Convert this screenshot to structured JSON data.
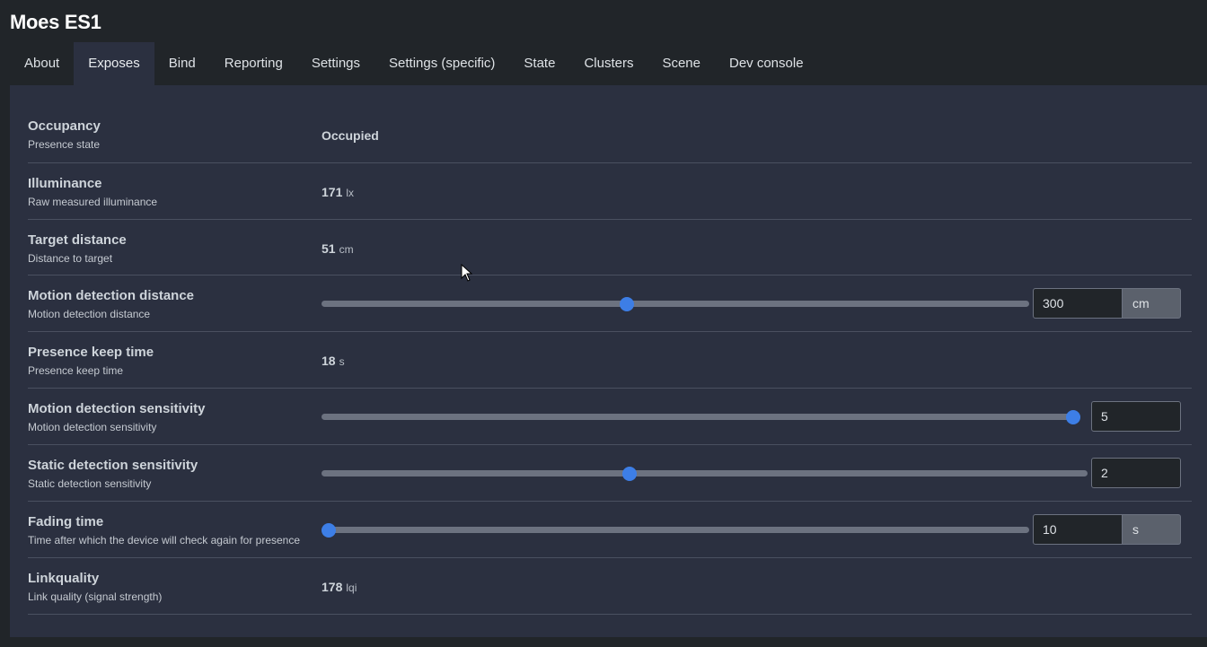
{
  "app": {
    "title": "Moes ES1"
  },
  "tabs": [
    {
      "label": "About"
    },
    {
      "label": "Exposes"
    },
    {
      "label": "Bind"
    },
    {
      "label": "Reporting"
    },
    {
      "label": "Settings"
    },
    {
      "label": "Settings (specific)"
    },
    {
      "label": "State"
    },
    {
      "label": "Clusters"
    },
    {
      "label": "Scene"
    },
    {
      "label": "Dev console"
    }
  ],
  "active_tab": "Exposes",
  "exposes": {
    "occupancy": {
      "title": "Occupancy",
      "desc": "Presence state",
      "value": "Occupied"
    },
    "illuminance": {
      "title": "Illuminance",
      "desc": "Raw measured illuminance",
      "value": "171",
      "unit": "lx"
    },
    "target_distance": {
      "title": "Target distance",
      "desc": "Distance to target",
      "value": "51",
      "unit": "cm"
    },
    "motion_detection_distance": {
      "title": "Motion detection distance",
      "desc": "Motion detection distance",
      "value": "300",
      "unit": "cm",
      "slider_fraction": 0.43
    },
    "presence_keep_time": {
      "title": "Presence keep time",
      "desc": "Presence keep time",
      "value": "18",
      "unit": "s"
    },
    "motion_detection_sensitivity": {
      "title": "Motion detection sensitivity",
      "desc": "Motion detection sensitivity",
      "value": "5",
      "slider_fraction": 1.0
    },
    "static_detection_sensitivity": {
      "title": "Static detection sensitivity",
      "desc": "Static detection sensitivity",
      "value": "2",
      "slider_fraction": 0.4
    },
    "fading_time": {
      "title": "Fading time",
      "desc": "Time after which the device will check again for presence",
      "value": "10",
      "unit": "s",
      "slider_fraction": 0.0
    },
    "linkquality": {
      "title": "Linkquality",
      "desc": "Link quality (signal strength)",
      "value": "178",
      "unit": "lqi"
    }
  },
  "colors": {
    "accent": "#3d7ee6",
    "background": "#212529",
    "panel": "#2b3040"
  }
}
